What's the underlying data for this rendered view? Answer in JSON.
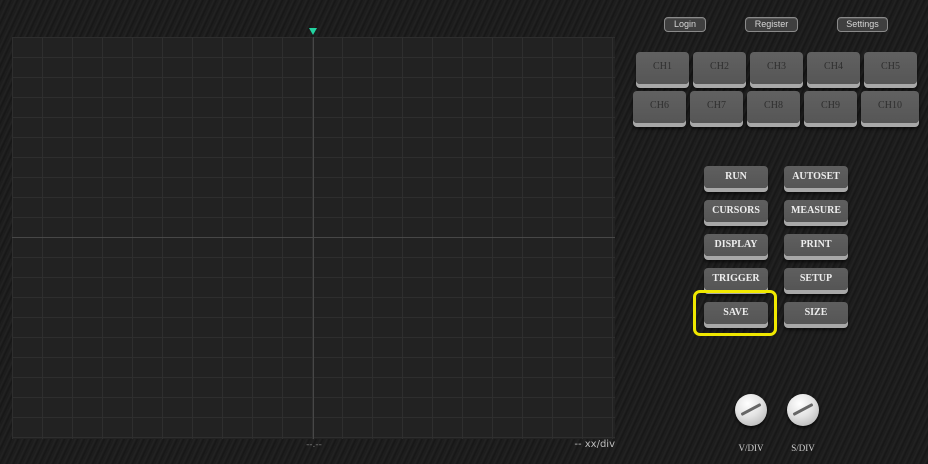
{
  "header": {
    "login_label": "Login",
    "register_label": "Register",
    "settings_label": "Settings"
  },
  "channels": [
    "CH1",
    "CH2",
    "CH3",
    "CH4",
    "CH5",
    "CH6",
    "CH7",
    "CH8",
    "CH9",
    "CH10"
  ],
  "controls": {
    "run": "RUN",
    "autoset": "AUTOSET",
    "cursors": "CURSORS",
    "measure": "MEASURE",
    "display": "DISPLAY",
    "print": "PRINT",
    "trigger": "TRIGGER",
    "setup": "SETUP",
    "save": "SAVE",
    "size": "SIZE"
  },
  "screen": {
    "center_readout": "--.--",
    "scale_readout": "-- xx/div"
  },
  "knobs": {
    "vdiv_label": "V/DIV",
    "sdiv_label": "S/DIV"
  },
  "colors": {
    "trigger_marker": "#22d3a0",
    "highlight": "#f0e800"
  }
}
